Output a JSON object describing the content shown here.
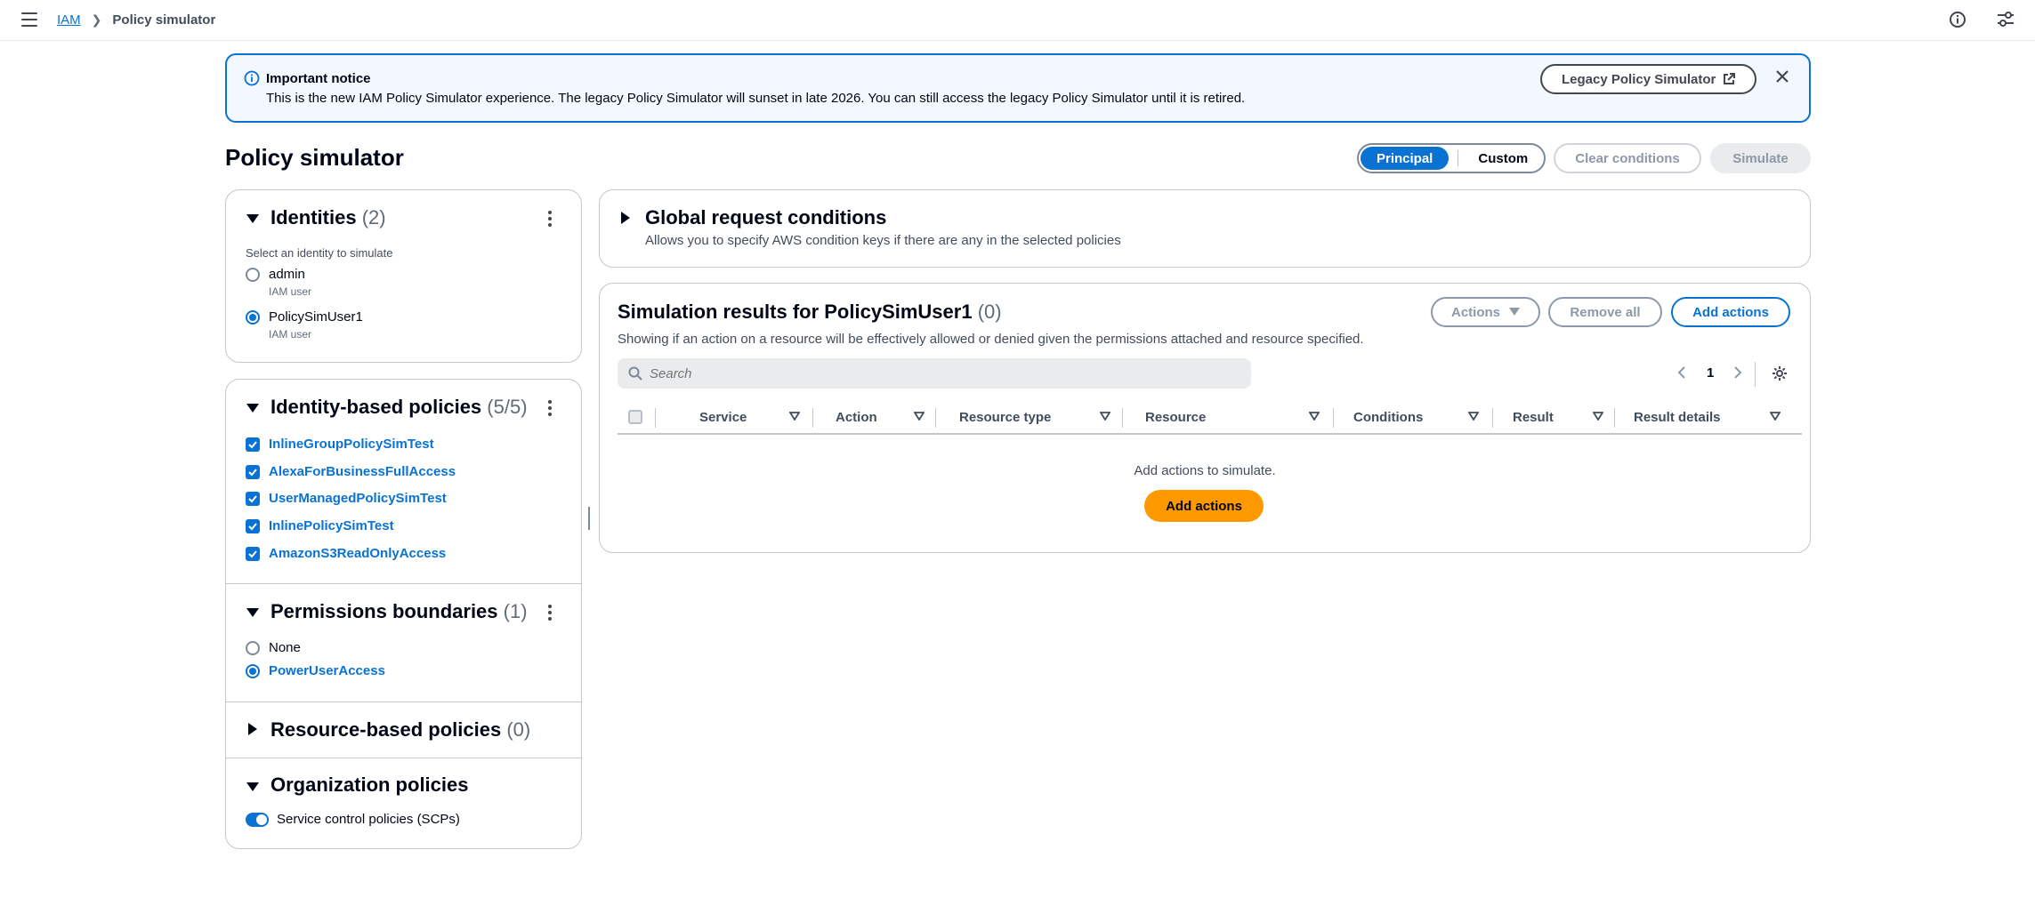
{
  "breadcrumb": {
    "root": "IAM",
    "current": "Policy simulator"
  },
  "notice": {
    "title": "Important notice",
    "body": "This is the new IAM Policy Simulator experience. The legacy Policy Simulator will sunset in late 2026. You can still access the legacy Policy Simulator until it is retired.",
    "legacy_button": "Legacy Policy Simulator"
  },
  "page": {
    "title": "Policy simulator"
  },
  "toolbar": {
    "mode_options": [
      "Principal",
      "Custom"
    ],
    "selected_mode": "Principal",
    "clear_conditions": "Clear conditions",
    "simulate": "Simulate"
  },
  "identities": {
    "title": "Identities",
    "count": "(2)",
    "prompt": "Select an identity to simulate",
    "items": [
      {
        "name": "admin",
        "type": "IAM user",
        "selected": false
      },
      {
        "name": "PolicySimUser1",
        "type": "IAM user",
        "selected": true
      }
    ]
  },
  "identity_policies": {
    "title": "Identity-based policies",
    "count": "(5/5)",
    "items": [
      "InlineGroupPolicySimTest",
      "AlexaForBusinessFullAccess",
      "UserManagedPolicySimTest",
      "InlinePolicySimTest",
      "AmazonS3ReadOnlyAccess"
    ]
  },
  "permissions_boundaries": {
    "title": "Permissions boundaries",
    "count": "(1)",
    "options": [
      {
        "label": "None",
        "selected": false
      },
      {
        "label": "PowerUserAccess",
        "selected": true
      }
    ]
  },
  "resource_policies": {
    "title": "Resource-based policies",
    "count": "(0)"
  },
  "org_policies": {
    "title": "Organization policies",
    "scp_label": "Service control policies (SCPs)",
    "scp_enabled": true
  },
  "global_conditions": {
    "title": "Global request conditions",
    "description": "Allows you to specify AWS condition keys if there are any in the selected policies"
  },
  "results": {
    "title": "Simulation results for PolicySimUser1",
    "count": "(0)",
    "description": "Showing if an action on a resource will be effectively allowed or denied given the permissions attached and resource specified.",
    "actions_button": "Actions",
    "remove_all": "Remove all",
    "add_actions": "Add actions",
    "search_placeholder": "Search",
    "page": "1",
    "columns": [
      "Service",
      "Action",
      "Resource type",
      "Resource",
      "Conditions",
      "Result",
      "Result details"
    ],
    "empty_message": "Add actions to simulate.",
    "empty_button": "Add actions"
  },
  "colors": {
    "primary": "#0972d3",
    "accent": "#ff9900",
    "text": "#000716"
  }
}
